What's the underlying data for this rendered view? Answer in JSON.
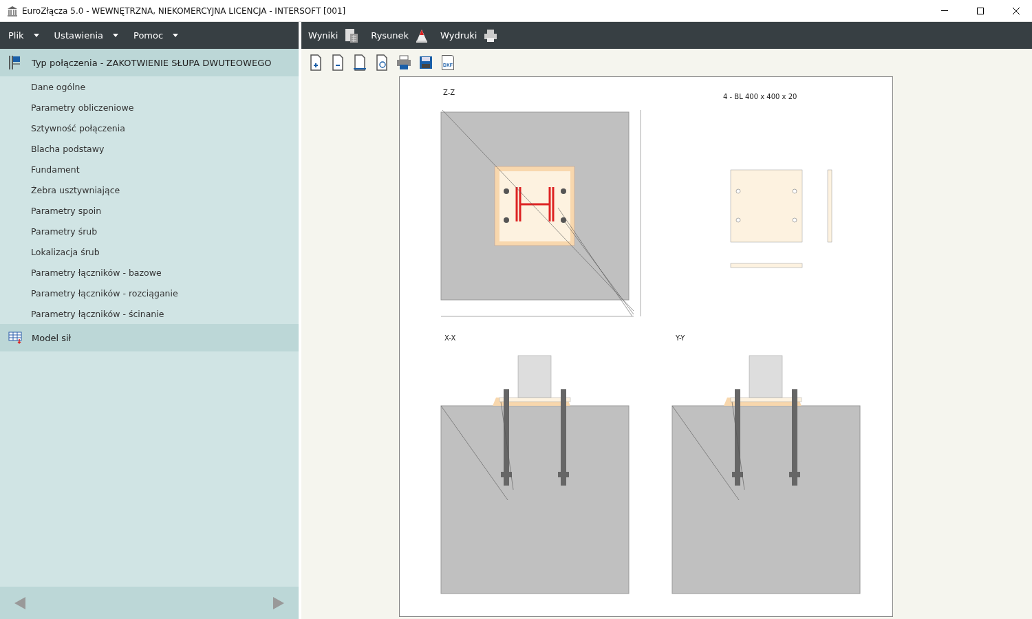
{
  "window": {
    "title": "EuroZłącza 5.0 - WEWNĘTRZNA, NIEKOMERCYJNA LICENCJA - INTERSOFT [001]"
  },
  "menu": [
    "Plik",
    "Ustawienia",
    "Pomoc"
  ],
  "nav": [
    {
      "kind": "type",
      "label": "Typ połączenia - ZAKOTWIENIE SŁUPA DWUTEOWEGO",
      "children": [
        "Dane ogólne",
        "Parametry obliczeniowe",
        "Sztywność połączenia",
        "Blacha podstawy",
        "Fundament",
        "Żebra usztywniające",
        "Parametry spoin",
        "Parametry śrub",
        "Lokalizacja śrub",
        "Parametry łączników - bazowe",
        "Parametry łączników - rozciąganie",
        "Parametry łączników - ścinanie"
      ]
    },
    {
      "kind": "forces",
      "label": "Model sił"
    }
  ],
  "views": [
    {
      "kind": "results",
      "label": "Wyniki"
    },
    {
      "kind": "drawing",
      "label": "Rysunek"
    },
    {
      "kind": "printouts",
      "label": "Wydruki"
    }
  ],
  "tools": [
    {
      "kind": "zoom-in"
    },
    {
      "kind": "zoom-out"
    },
    {
      "kind": "fit-width"
    },
    {
      "kind": "preview"
    },
    {
      "kind": "print"
    },
    {
      "kind": "save"
    },
    {
      "kind": "dxf",
      "label": "DXF"
    }
  ],
  "drawing": {
    "plan_label": "Z-Z",
    "plate_label": "4 - BL 400 x 400 x 20",
    "section_labels": [
      "X-X",
      "Y-Y"
    ]
  }
}
